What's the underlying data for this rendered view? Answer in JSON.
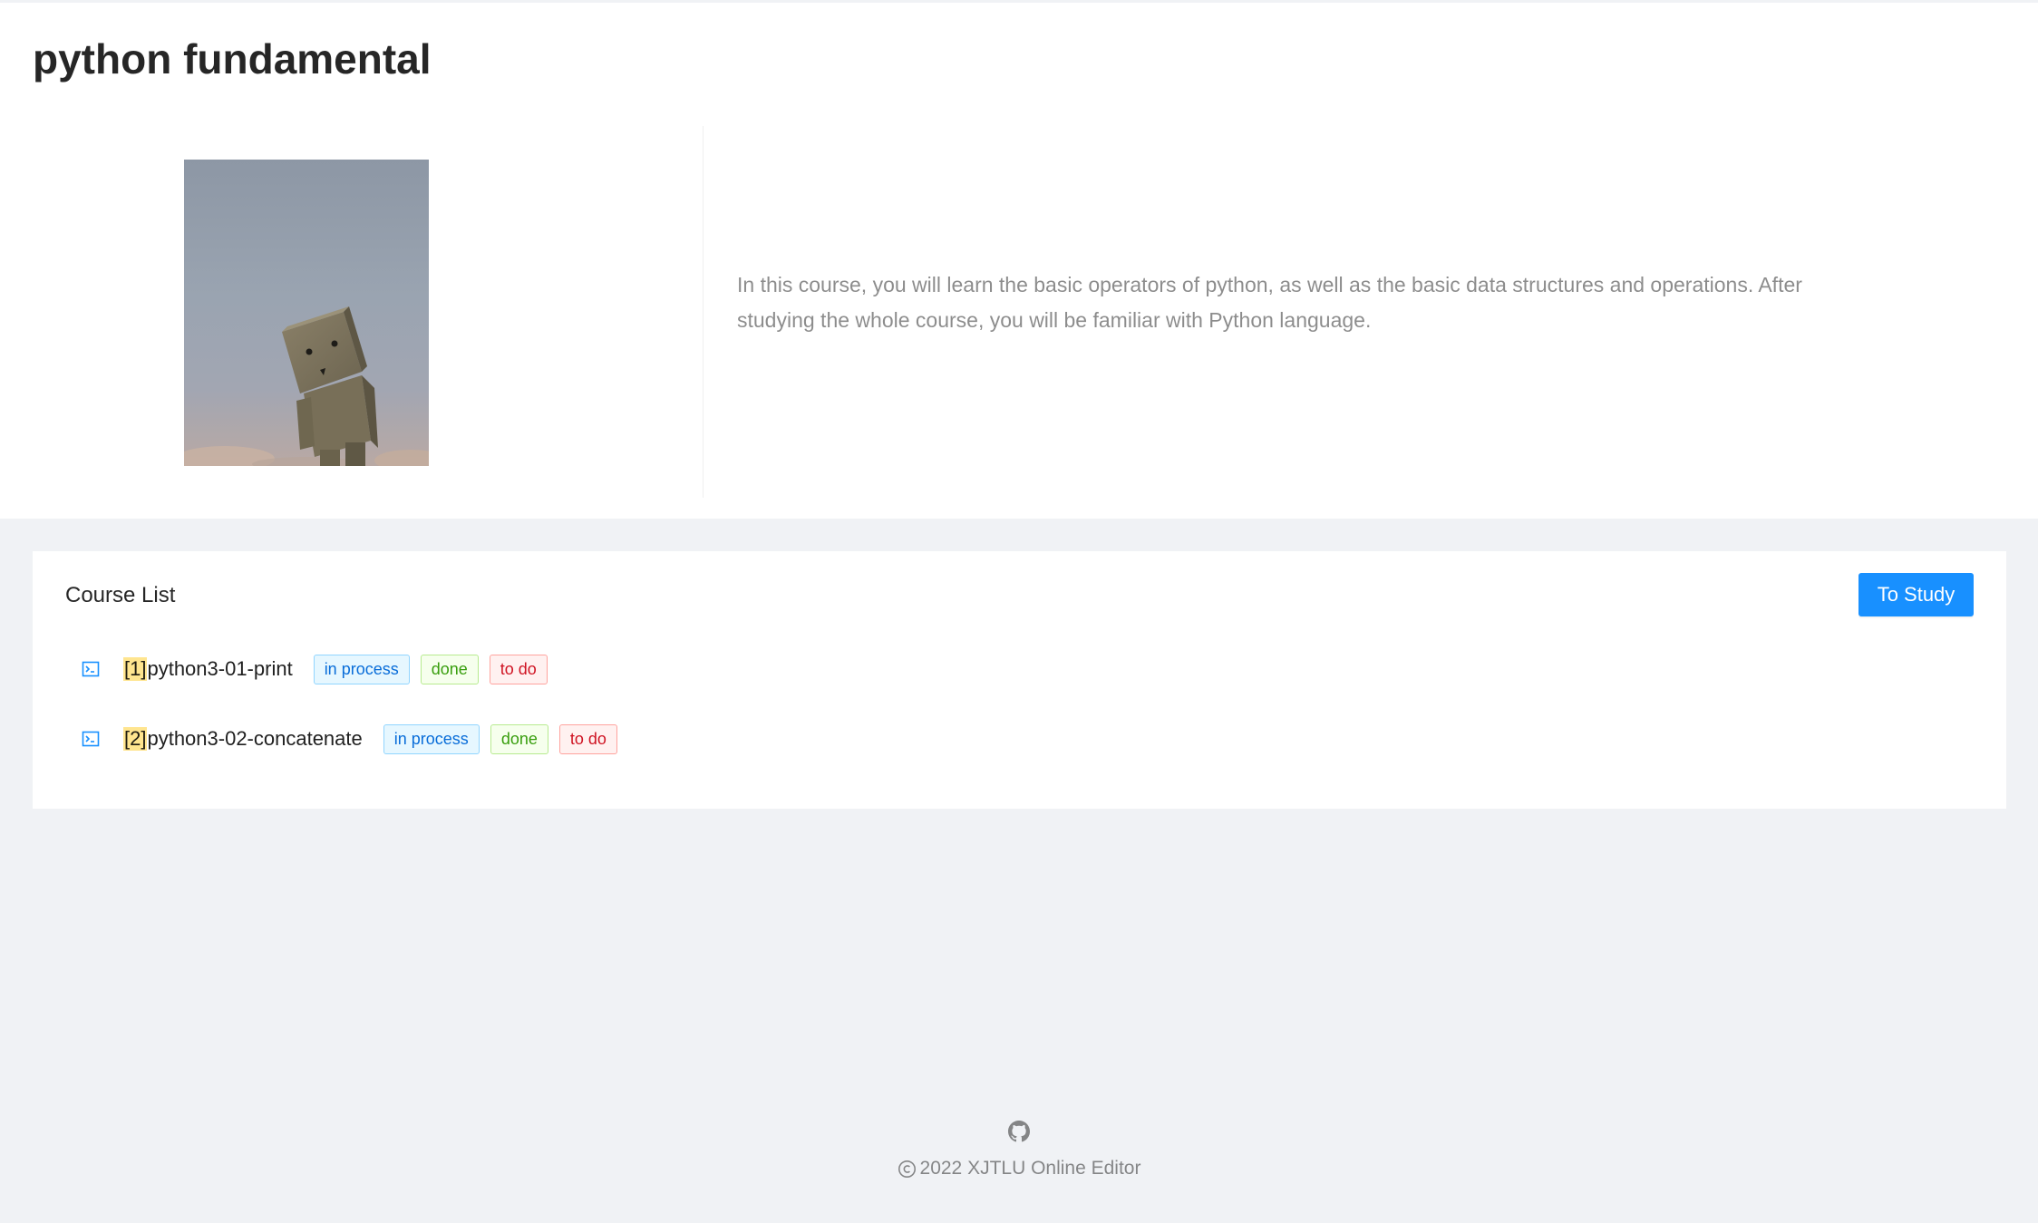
{
  "page": {
    "title": "python fundamental",
    "cover_image": "cardboard-robot-photo",
    "description": "In this course, you will learn the basic operators of python, as well as the basic data structures and operations. After studying the whole course, you will be familiar with Python language."
  },
  "course_list": {
    "title": "Course List",
    "study_button_label": "To Study",
    "lessons": [
      {
        "index": "[1]",
        "name": "python3-01-print",
        "icon": "code-icon",
        "tags": [
          "in process",
          "done",
          "to do"
        ]
      },
      {
        "index": "[2]",
        "name": "python3-02-concatenate",
        "icon": "code-icon",
        "tags": [
          "in process",
          "done",
          "to do"
        ]
      }
    ]
  },
  "footer": {
    "github_icon": "github-icon",
    "copyright_text": "2022 XJTLU Online Editor"
  },
  "colors": {
    "primary": "#1890ff",
    "tag_blue": "#096dd9",
    "tag_green": "#389e0d",
    "tag_red": "#cf1322",
    "background": "#f0f2f5"
  }
}
